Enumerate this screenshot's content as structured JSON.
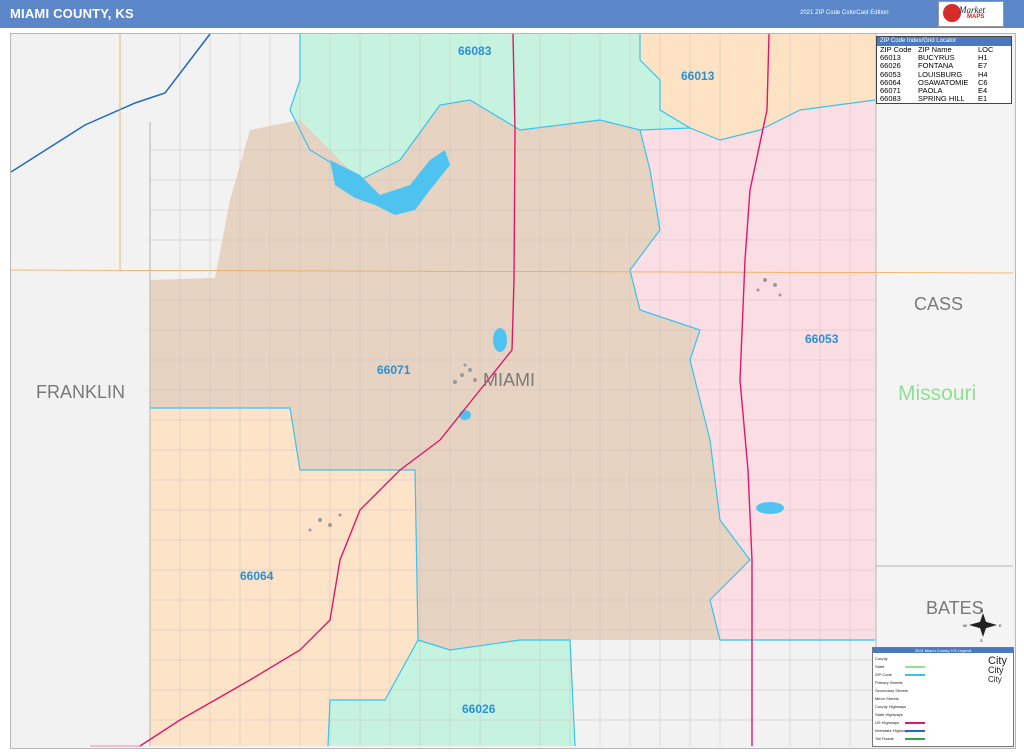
{
  "header": {
    "title": "MIAMI COUNTY, KS",
    "edition": "2021 ZIP Code ColorCast Edition",
    "logo_text": "Market",
    "logo_sub": "MAPS"
  },
  "labels": {
    "county_center": "MIAMI",
    "county_west": "FRANKLIN",
    "county_east": "CASS",
    "county_southeast": "BATES",
    "state_east": "Missouri"
  },
  "zip_labels": {
    "z66083": "66083",
    "z66013": "66013",
    "z66071": "66071",
    "z66053": "66053",
    "z66064": "66064",
    "z66026": "66026"
  },
  "zone_colors": {
    "z66083": "#c6f3df",
    "z66013": "#fde3c4",
    "z66071": "#e6d3c2",
    "z66053": "#fbdde4",
    "z66064": "#fde4c9",
    "z66026": "#c6f3df",
    "outside": "#f2f2f2",
    "water": "#4fc3ef",
    "boundary": "#38c3f0",
    "highway": "#e0186a",
    "interstate": "#1f6bc2"
  },
  "locator": {
    "title": "ZIP Code Index/Grid Locator",
    "headers": {
      "zip": "ZIP Code",
      "name": "ZIP Name",
      "loc": "LOC"
    },
    "rows": [
      {
        "zip": "66013",
        "name": "BUCYRUS",
        "loc": "H1"
      },
      {
        "zip": "66026",
        "name": "FONTANA",
        "loc": "E7"
      },
      {
        "zip": "66053",
        "name": "LOUISBURG",
        "loc": "H4"
      },
      {
        "zip": "66064",
        "name": "OSAWATOMIE",
        "loc": "C6"
      },
      {
        "zip": "66071",
        "name": "PAOLA",
        "loc": "E4"
      },
      {
        "zip": "66083",
        "name": "SPRING HILL",
        "loc": "E1"
      }
    ]
  },
  "legend": {
    "title": "2021 Miami County, KS Legend",
    "items": [
      "County",
      "State",
      "ZIP Code",
      "Primary Streets",
      "Secondary Streets",
      "Minor Streets",
      "County Highways",
      "State Highways",
      "US Highways",
      "Interstate Highways",
      "Toll Roads"
    ],
    "city_sample": [
      "City",
      "City",
      "City"
    ]
  },
  "compass": {
    "n": "N",
    "s": "S",
    "e": "E",
    "w": "W"
  }
}
